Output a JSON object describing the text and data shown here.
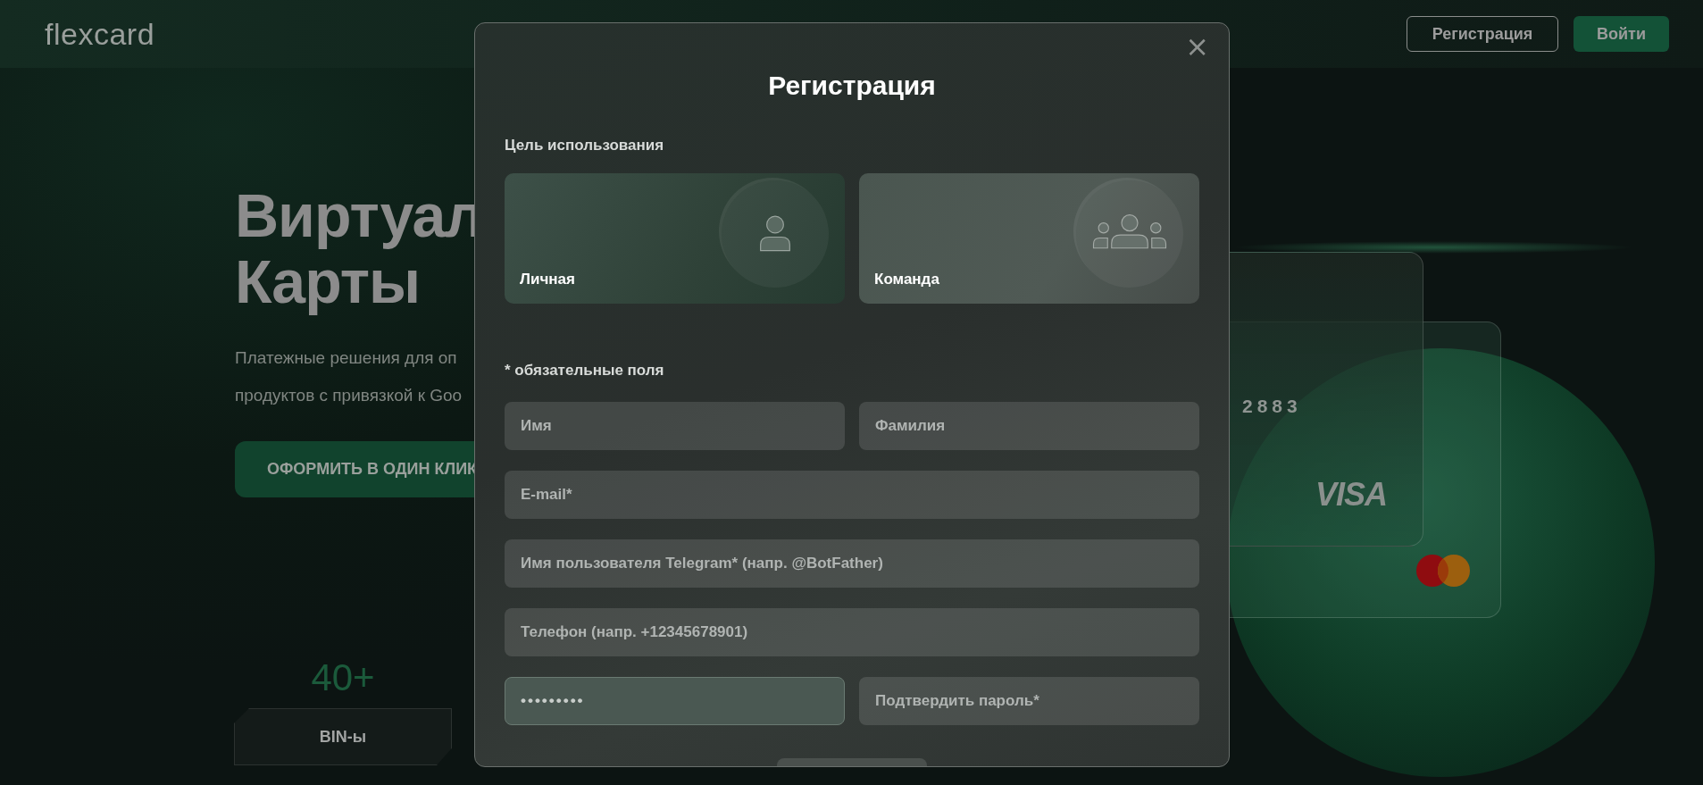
{
  "header": {
    "logo": "flexcard",
    "buttons": [
      {
        "label": "Регистрация",
        "kind": "outline"
      },
      {
        "label": "Войти",
        "kind": "filled"
      }
    ]
  },
  "hero": {
    "title_lines": [
      "Виртуал",
      "Карты"
    ],
    "paragraph_lines": [
      "Платежные решения для оп",
      "продуктов с привязкой к Goo"
    ],
    "cta": "ОФОРМИТЬ В ОДИН КЛИК",
    "stat": {
      "value": "40+",
      "label": "BIN-ы"
    }
  },
  "cards": {
    "number": "2883",
    "brand": "VISA"
  },
  "modal": {
    "title": "Регистрация",
    "close": "×",
    "purpose_label": "Цель использования",
    "options": [
      {
        "label": "Личная",
        "kind": "person",
        "selected": true
      },
      {
        "label": "Команда",
        "kind": "team",
        "selected": false
      }
    ],
    "required_note": "* обязательные поля",
    "fields": [
      [
        {
          "placeholder": "Имя",
          "focused": false
        },
        {
          "placeholder": "Фамилия",
          "focused": false
        }
      ],
      [
        {
          "placeholder": "E-mail*",
          "focused": false
        }
      ],
      [
        {
          "placeholder": "Имя пользователя Telegram* (напр. @BotFather)",
          "focused": false
        }
      ],
      [
        {
          "placeholder": "Телефон (напр. +12345678901)",
          "focused": false
        }
      ],
      [
        {
          "value": "•••••••••",
          "focused": true
        },
        {
          "placeholder": "Подтвердить пароль*",
          "focused": false
        }
      ]
    ]
  }
}
